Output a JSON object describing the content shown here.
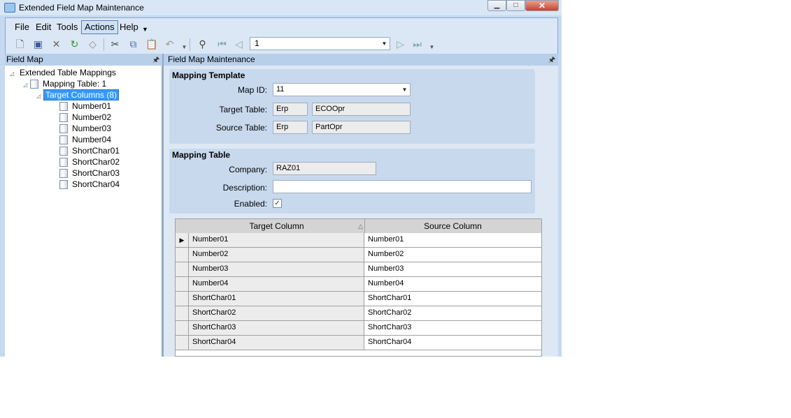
{
  "window": {
    "title": "Extended Field Map Maintenance",
    "controls": [
      "minimize",
      "maximize",
      "close"
    ]
  },
  "menu": [
    "File",
    "Edit",
    "Tools",
    "Actions",
    "Help"
  ],
  "record_nav": {
    "value": "1"
  },
  "left_panel": {
    "title": "Field Map",
    "tree": {
      "root": "Extended Table Mappings",
      "level1": "Mapping Table: 1",
      "level2": "Target Columns (8)",
      "leaves": [
        "Number01",
        "Number02",
        "Number03",
        "Number04",
        "ShortChar01",
        "ShortChar02",
        "ShortChar03",
        "ShortChar04"
      ]
    }
  },
  "right_panel": {
    "title": "Field Map Maintenance",
    "mapping_template": {
      "title": "Mapping Template",
      "map_id_label": "Map ID:",
      "map_id": "11",
      "target_table_label": "Target Table:",
      "target_schema": "Erp",
      "target_table": "ECOOpr",
      "source_table_label": "Source Table:",
      "source_schema": "Erp",
      "source_table": "PartOpr"
    },
    "mapping_table": {
      "title": "Mapping Table",
      "company_label": "Company:",
      "company": "RAZ01",
      "description_label": "Description:",
      "description": "",
      "enabled_label": "Enabled:",
      "enabled": true
    },
    "grid": {
      "headers": [
        "Target Column",
        "Source Column"
      ],
      "rows": [
        {
          "target": "Number01",
          "source": "Number01"
        },
        {
          "target": "Number02",
          "source": "Number02"
        },
        {
          "target": "Number03",
          "source": "Number03"
        },
        {
          "target": "Number04",
          "source": "Number04"
        },
        {
          "target": "ShortChar01",
          "source": "ShortChar01"
        },
        {
          "target": "ShortChar02",
          "source": "ShortChar02"
        },
        {
          "target": "ShortChar03",
          "source": "ShortChar03"
        },
        {
          "target": "ShortChar04",
          "source": "ShortChar04"
        }
      ]
    }
  }
}
